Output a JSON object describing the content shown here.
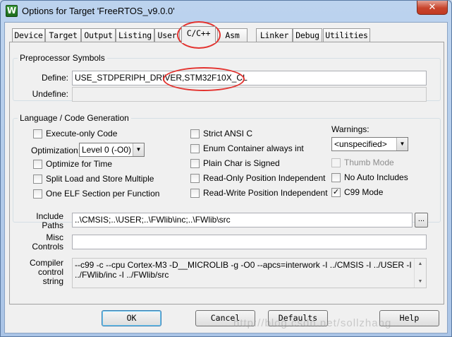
{
  "window": {
    "title": "Options for Target 'FreeRTOS_v9.0.0'",
    "icon_letter": "W",
    "icon_name": "keil-app-icon",
    "close_glyph": "✕"
  },
  "tabs": [
    {
      "label": "Device"
    },
    {
      "label": "Target"
    },
    {
      "label": "Output"
    },
    {
      "label": "Listing"
    },
    {
      "label": "User"
    },
    {
      "label": "C/C++",
      "active": true
    },
    {
      "label": "Asm"
    },
    {
      "label": "Linker"
    },
    {
      "label": "Debug"
    },
    {
      "label": "Utilities"
    }
  ],
  "preprocessor": {
    "legend": "Preprocessor Symbols",
    "define_label": "Define:",
    "define_value": "USE_STDPERIPH_DRIVER,STM32F10X_CL",
    "undefine_label": "Undefine:",
    "undefine_value": ""
  },
  "language": {
    "legend": "Language / Code Generation",
    "execute_only": {
      "label": "Execute-only Code",
      "checked": false
    },
    "optimization_label": "Optimization:",
    "optimization_value": "Level 0 (-O0)",
    "optimize_time": {
      "label": "Optimize for Time",
      "checked": false
    },
    "split_load": {
      "label": "Split Load and Store Multiple",
      "checked": false
    },
    "one_elf": {
      "label": "One ELF Section per Function",
      "checked": false
    },
    "strict_ansi": {
      "label": "Strict ANSI C",
      "checked": false
    },
    "enum_container": {
      "label": "Enum Container always int",
      "checked": false
    },
    "plain_char": {
      "label": "Plain Char is Signed",
      "checked": false
    },
    "ropi": {
      "label": "Read-Only Position Independent",
      "checked": false
    },
    "rwpi": {
      "label": "Read-Write Position Independent",
      "checked": false
    },
    "warnings_label": "Warnings:",
    "warnings_value": "<unspecified>",
    "thumb_mode": {
      "label": "Thumb Mode",
      "checked": false,
      "disabled": true
    },
    "no_auto_includes": {
      "label": "No Auto Includes",
      "checked": false
    },
    "c99_mode": {
      "label": "C99 Mode",
      "checked": true
    }
  },
  "include_paths": {
    "label_line1": "Include",
    "label_line2": "Paths",
    "value": "..\\CMSIS;..\\USER;..\\FWlib\\inc;..\\FWlib\\src",
    "browse_label": "..."
  },
  "misc_controls": {
    "label_line1": "Misc",
    "label_line2": "Controls",
    "value": ""
  },
  "compiler_control": {
    "label_line1": "Compiler",
    "label_line2": "control",
    "label_line3": "string",
    "value": "--c99 -c --cpu Cortex-M3 -D__MICROLIB -g -O0 --apcs=interwork -I ../CMSIS -I ../USER -I ../FWlib/inc -I ../FWlib/src"
  },
  "buttons": {
    "ok": "OK",
    "cancel": "Cancel",
    "defaults": "Defaults",
    "help": "Help"
  },
  "watermark": "http://blog.csdn.net/sollzhang",
  "colors": {
    "annotation_red": "#e3332f",
    "title_bar": "#bcd3ee",
    "dialog_bg": "#f0f0f0"
  }
}
